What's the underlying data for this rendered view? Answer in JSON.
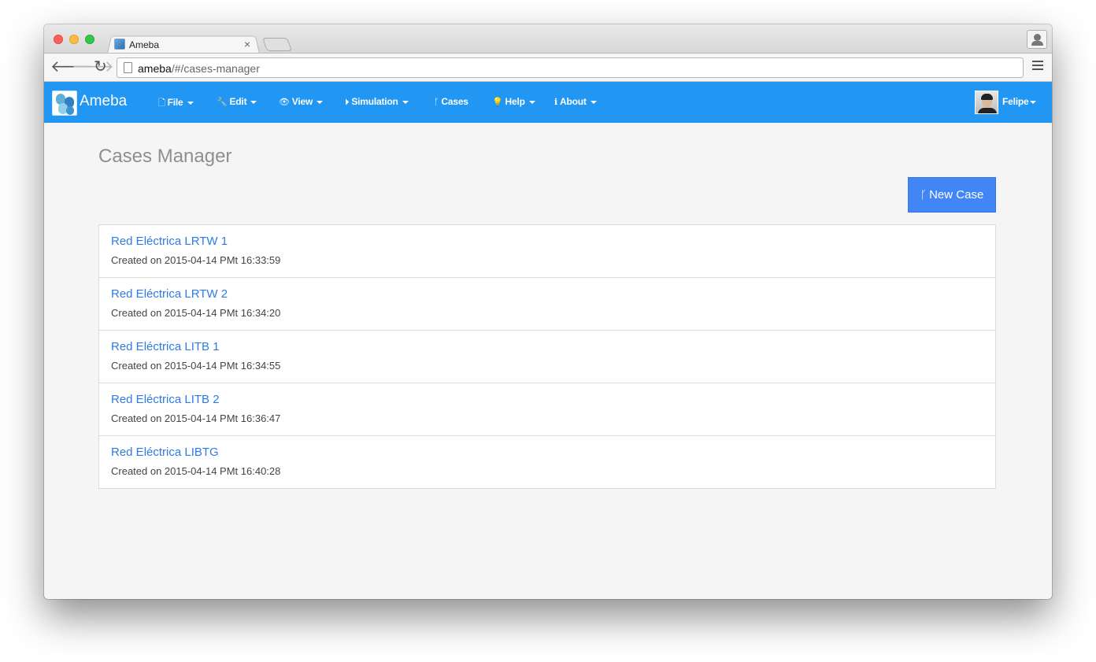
{
  "browser": {
    "tab_title": "Ameba",
    "tab_close": "×",
    "url_host": "ameba",
    "url_path": "/#/cases-manager",
    "icons": {
      "back": "back-arrow-icon",
      "forward": "forward-arrow-icon",
      "reload": "reload-icon",
      "page": "page-icon",
      "menu": "hamburger-menu-icon",
      "profile": "person-icon"
    }
  },
  "navbar": {
    "brand": "Ameba",
    "accent_color": "#2196f3",
    "items": [
      {
        "label": "File",
        "icon": "file-icon",
        "glyph": "🗋",
        "has_caret": true
      },
      {
        "label": "Edit",
        "icon": "wrench-icon",
        "glyph": "🔧",
        "has_caret": true
      },
      {
        "label": "View",
        "icon": "eye-icon",
        "glyph": "👁",
        "has_caret": true
      },
      {
        "label": "Simulation",
        "icon": "play-circle-icon",
        "glyph": "⏵",
        "has_caret": true
      },
      {
        "label": "Cases",
        "icon": "branch-icon",
        "glyph": "ᚴ",
        "has_caret": false
      },
      {
        "label": "Help",
        "icon": "lightbulb-icon",
        "glyph": "💡",
        "has_caret": true
      },
      {
        "label": "About",
        "icon": "info-circle-icon",
        "glyph": "ℹ",
        "has_caret": true
      }
    ],
    "user": {
      "name": "Felipe"
    }
  },
  "main": {
    "title": "Cases Manager",
    "new_case_label": "New Case",
    "new_case_glyph": "ᚴ",
    "cases": [
      {
        "name": "Red Eléctrica LRTW 1",
        "created": "Created on 2015-04-14 PMt 16:33:59"
      },
      {
        "name": "Red Eléctrica LRTW 2",
        "created": "Created on 2015-04-14 PMt 16:34:20"
      },
      {
        "name": "Red Eléctrica LITB 1",
        "created": "Created on 2015-04-14 PMt 16:34:55"
      },
      {
        "name": "Red Eléctrica LITB 2",
        "created": "Created on 2015-04-14 PMt 16:36:47"
      },
      {
        "name": "Red Eléctrica LIBTG",
        "created": "Created on 2015-04-14 PMt 16:40:28"
      }
    ]
  }
}
